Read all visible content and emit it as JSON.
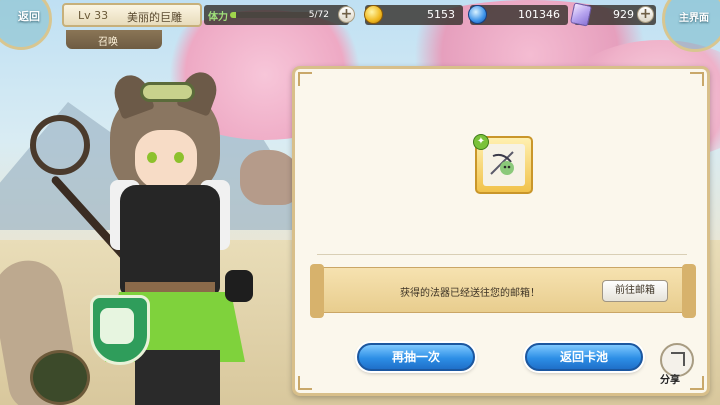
{
  "nav": {
    "back_label": "返回",
    "home_label": "主界面",
    "level": "Lv 33",
    "player_name": "美丽的巨雕",
    "tab_label": "召唤"
  },
  "resources": {
    "stamina_label": "体力",
    "stamina_value": "5/72",
    "stamina_fraction": 0.07,
    "gold": "5153",
    "crystal": "101346",
    "gem": "929"
  },
  "result": {
    "notice": "获得的法器已经送往您的邮箱！",
    "mail_button": "前往邮箱",
    "draw_again": "再抽一次",
    "return_pool": "返回卡池",
    "share": "分享"
  },
  "colors": {
    "accent_blue": "#2d8fe6",
    "panel_border": "#d8bf8a",
    "stamina_fill": "#9fd64c"
  }
}
